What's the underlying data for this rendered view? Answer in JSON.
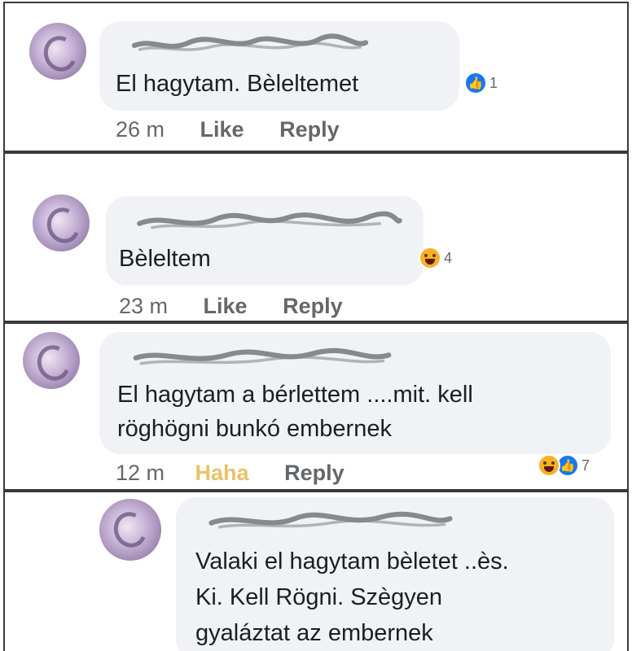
{
  "comments": [
    {
      "text_lines": [
        "El  hagytam.  Bèleltemet"
      ],
      "reaction": {
        "icon": "like-icon",
        "count": "1"
      },
      "meta": {
        "time": "26 m",
        "action": "Like",
        "reply": "Reply"
      }
    },
    {
      "text_lines": [
        "Bèleltem"
      ],
      "reaction": {
        "icon": "haha-icon",
        "count": "4"
      },
      "meta": {
        "time": "23 m",
        "action": "Like",
        "reply": "Reply"
      }
    },
    {
      "text_lines": [
        "El hagytam a bérlettem  ....mit. kell",
        "röghögni  bunkó embernek"
      ],
      "reaction": {
        "icons": [
          "haha-icon",
          "like-icon"
        ],
        "count": "7"
      },
      "meta": {
        "time": "12 m",
        "action": "Haha",
        "reply": "Reply"
      }
    },
    {
      "text_lines": [
        "Valaki el hagytam bèletet ..ès.",
        "Ki. Kell Rögni.  Szègyen",
        "gyaláztat az embernek"
      ]
    }
  ],
  "colors": {
    "bubble": "#f0f2f5",
    "like_blue": "#1877f2",
    "haha_yellow": "#f7b125",
    "meta_gray": "#65676b",
    "haha_text": "#e6c36a"
  }
}
